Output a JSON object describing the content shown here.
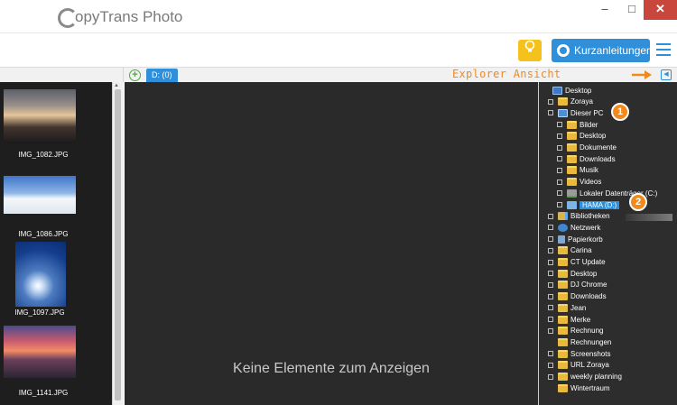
{
  "app": {
    "title": "CopyTrans Photo",
    "logo_rest": "opyTrans Photo"
  },
  "window": {
    "minimize": "–",
    "maximize": "□",
    "close": "✕"
  },
  "toolbar": {
    "bulb_icon": "bulb-icon",
    "guide_label": "Kurzanleitungen",
    "menu_icon": "hamburger-menu-icon"
  },
  "device_tabs": {
    "add_icon": "plus-circle-icon",
    "active_tab": "D: (0)"
  },
  "annotation": {
    "explorer_label": "Explorer Ansicht",
    "badge_1": "1",
    "badge_2": "2",
    "accent_color": "#f08a1c"
  },
  "left_panel": {
    "thumbnails": [
      {
        "filename": "IMG_1082.JPG"
      },
      {
        "filename": "IMG_1086.JPG"
      },
      {
        "filename": "IMG_1097.JPG"
      },
      {
        "filename": "IMG_1141.JPG"
      }
    ]
  },
  "center_panel": {
    "empty_message": "Keine Elemente zum Anzeigen"
  },
  "explorer_tree": [
    {
      "label": "Desktop",
      "icon": "desktop"
    },
    {
      "label": "Zoraya",
      "icon": "folder"
    },
    {
      "label": "Dieser PC",
      "icon": "pc"
    },
    {
      "label": "Bilder",
      "icon": "folder"
    },
    {
      "label": "Desktop",
      "icon": "folder"
    },
    {
      "label": "Dokumente",
      "icon": "folder"
    },
    {
      "label": "Downloads",
      "icon": "folder"
    },
    {
      "label": "Musik",
      "icon": "folder"
    },
    {
      "label": "Videos",
      "icon": "folder"
    },
    {
      "label": "Lokaler Datenträger (C:)",
      "icon": "drive"
    },
    {
      "label": "HAMA (D:)",
      "icon": "usb",
      "selected": true
    },
    {
      "label": "Bibliotheken",
      "icon": "lib"
    },
    {
      "label": "Netzwerk",
      "icon": "net"
    },
    {
      "label": "Papierkorb",
      "icon": "trash"
    },
    {
      "label": "Carina",
      "icon": "folder"
    },
    {
      "label": "CT Update",
      "icon": "folder"
    },
    {
      "label": "Desktop",
      "icon": "folder"
    },
    {
      "label": "DJ Chrome",
      "icon": "folder"
    },
    {
      "label": "Downloads",
      "icon": "folder"
    },
    {
      "label": "Jean",
      "icon": "folder"
    },
    {
      "label": "Merke",
      "icon": "folder"
    },
    {
      "label": "Rechnung",
      "icon": "folder"
    },
    {
      "label": "Rechnungen",
      "icon": "folder"
    },
    {
      "label": "Screenshots",
      "icon": "folder"
    },
    {
      "label": "URL Zoraya",
      "icon": "folder"
    },
    {
      "label": "weekly planning",
      "icon": "folder"
    },
    {
      "label": "Wintertraum",
      "icon": "folder"
    }
  ]
}
